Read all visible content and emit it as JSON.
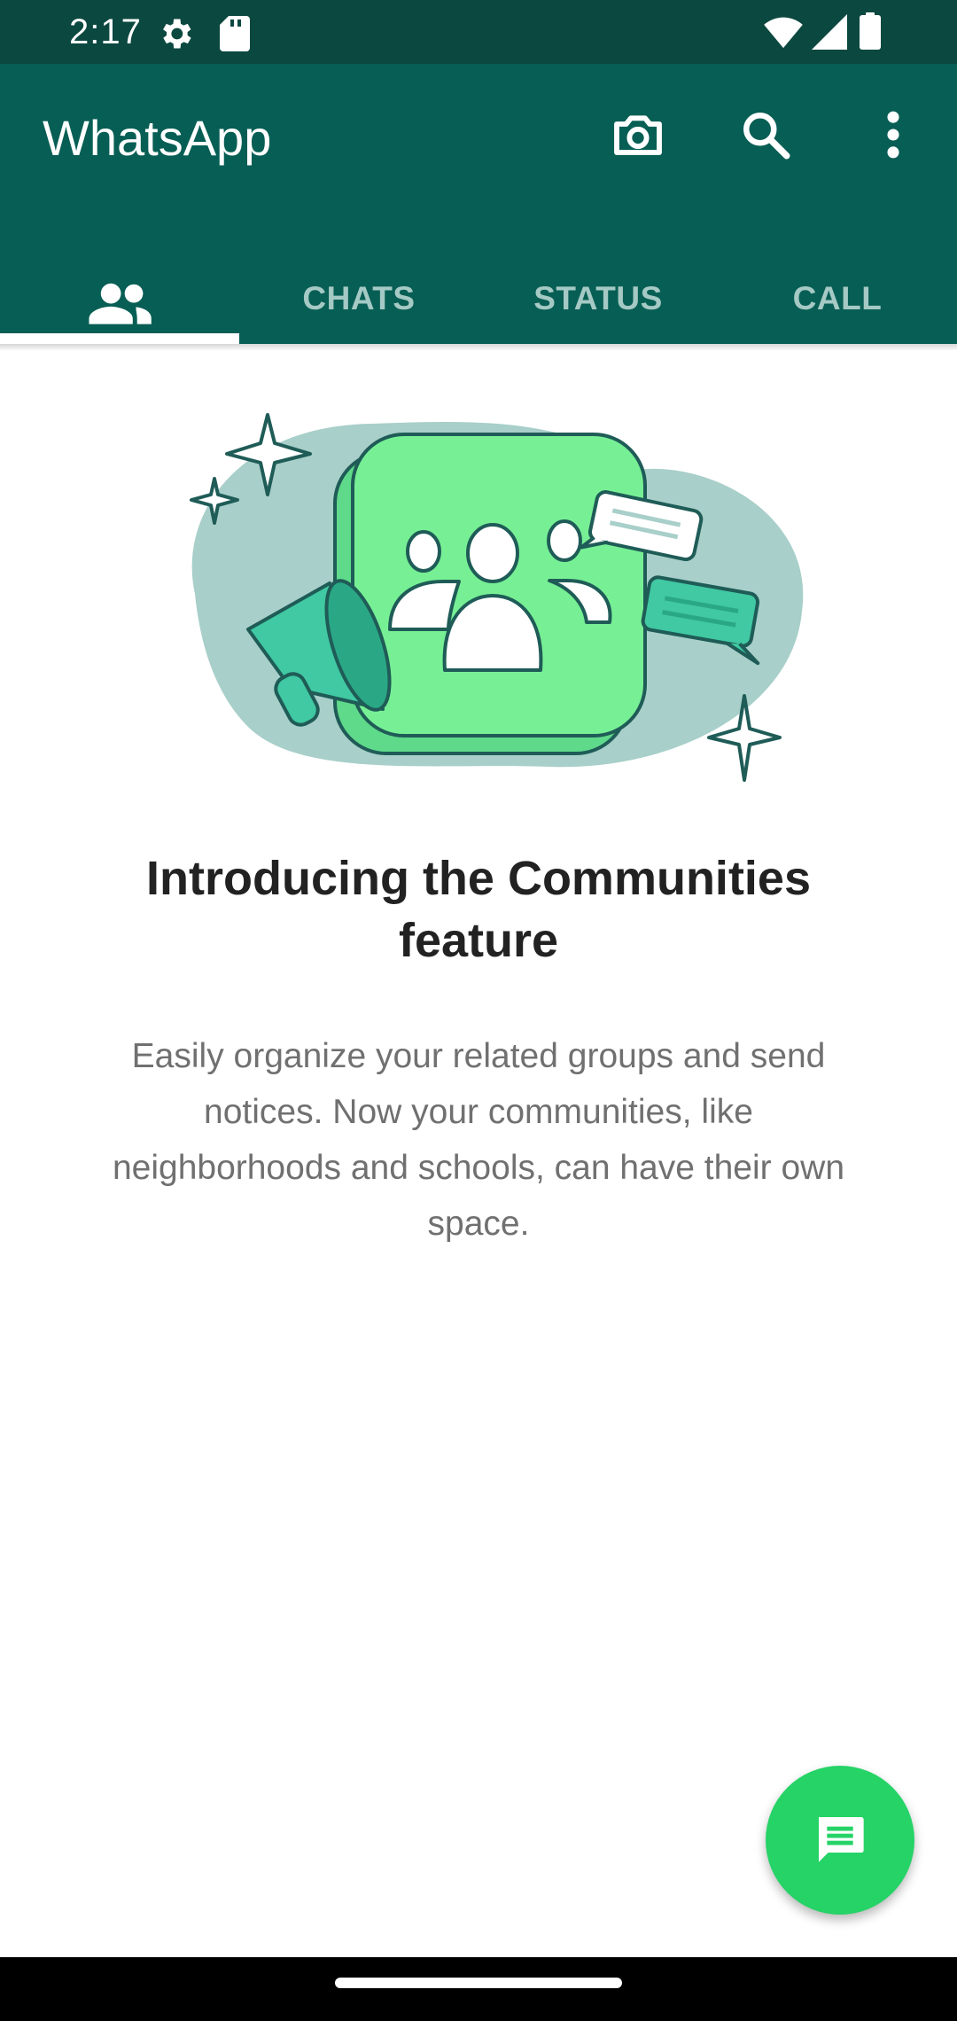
{
  "status_bar": {
    "time": "2:17",
    "icons": [
      "settings-gear-icon",
      "sd-card-icon",
      "wifi-icon",
      "signal-icon",
      "battery-icon"
    ]
  },
  "app_bar": {
    "title": "WhatsApp",
    "actions": [
      "camera-icon",
      "search-icon",
      "more-options-icon"
    ]
  },
  "tabs": [
    {
      "label": "",
      "icon": "communities-icon",
      "selected": true
    },
    {
      "label": "CHATS",
      "selected": false
    },
    {
      "label": "STATUS",
      "selected": false
    },
    {
      "label": "CALL",
      "selected": false
    }
  ],
  "intro": {
    "title": "Introducing the Communities feature",
    "body": "Easily organize your related groups and send notices. Now your communities, like neighborhoods and schools, can have their own space."
  },
  "fab": {
    "icon": "new-chat-message-icon"
  },
  "colors": {
    "status_bar": "#0b4840",
    "app_bar": "#075e54",
    "tab_inactive_text": "#a5c9c4",
    "fab": "#25d366",
    "title_text": "#222222",
    "body_text": "#707070"
  }
}
